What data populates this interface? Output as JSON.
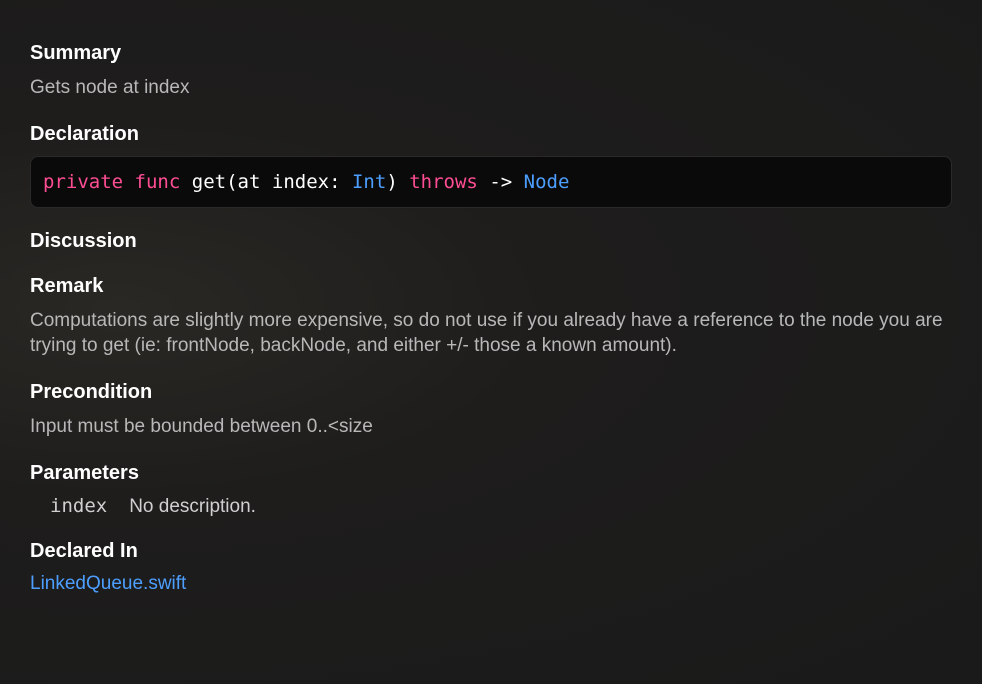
{
  "summary": {
    "heading": "Summary",
    "text": "Gets node at index"
  },
  "declaration": {
    "heading": "Declaration",
    "tokens": {
      "private": "private",
      "func": "func",
      "name": "get",
      "open_paren": "(",
      "at": "at",
      "param": "index",
      "colon": ":",
      "type": "Int",
      "close_paren": ")",
      "throws": "throws",
      "arrow": "->",
      "return_type": "Node"
    }
  },
  "discussion": {
    "heading": "Discussion"
  },
  "remark": {
    "heading": "Remark",
    "text": "Computations are slightly more expensive, so do not use if you already have a reference to the node you are trying to get (ie: frontNode, backNode, and either +/- those a known amount)."
  },
  "precondition": {
    "heading": "Precondition",
    "text": "Input must be bounded between 0..<size"
  },
  "parameters": {
    "heading": "Parameters",
    "items": [
      {
        "name": "index",
        "description": "No description."
      }
    ]
  },
  "declared_in": {
    "heading": "Declared In",
    "file": "LinkedQueue.swift"
  }
}
